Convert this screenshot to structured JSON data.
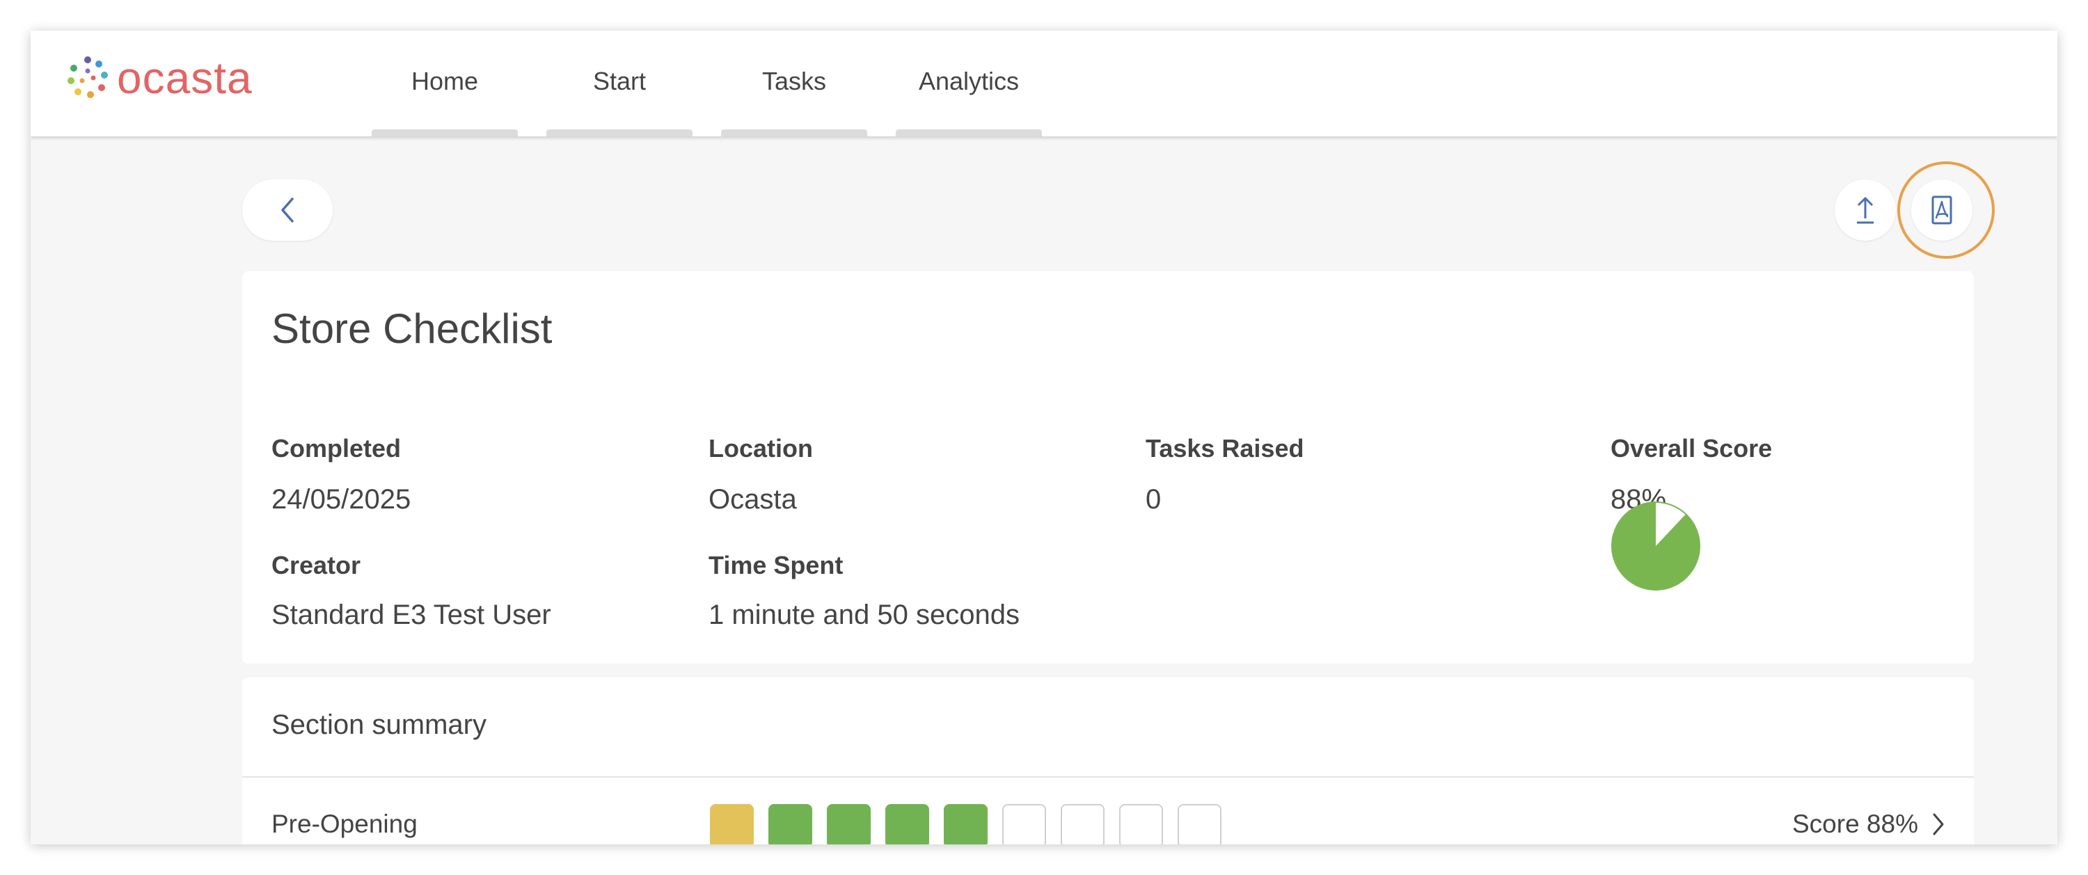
{
  "brand": {
    "name": "ocasta",
    "color": "#e36464"
  },
  "nav": {
    "items": [
      {
        "label": "Home"
      },
      {
        "label": "Start"
      },
      {
        "label": "Tasks"
      },
      {
        "label": "Analytics"
      }
    ]
  },
  "toolbar": {
    "back_icon": "chevron-left-icon",
    "upload_icon": "upload-icon",
    "pdf_icon": "pdf-icon",
    "highlight_color": "#e8a04a"
  },
  "report": {
    "title": "Store Checklist",
    "fields": {
      "completed": {
        "label": "Completed",
        "value": "24/05/2025"
      },
      "location": {
        "label": "Location",
        "value": "Ocasta"
      },
      "tasks_raised": {
        "label": "Tasks Raised",
        "value": "0"
      },
      "overall_score": {
        "label": "Overall Score",
        "value": "88%",
        "fraction": 0.88,
        "color": "#7ab650"
      },
      "creator": {
        "label": "Creator",
        "value": "Standard E3 Test User"
      },
      "time_spent": {
        "label": "Time Spent",
        "value": "1 minute and 50 seconds"
      }
    }
  },
  "section_summary": {
    "title": "Section summary",
    "rows": [
      {
        "label": "Pre-Opening",
        "score_text": "Score 88%",
        "squares": [
          "yellow",
          "green",
          "green",
          "green",
          "green",
          "empty",
          "empty",
          "empty",
          "empty"
        ]
      }
    ]
  },
  "colors": {
    "green": "#71b353",
    "yellow": "#e4c25a",
    "empty_border": "#cfcfcf"
  }
}
